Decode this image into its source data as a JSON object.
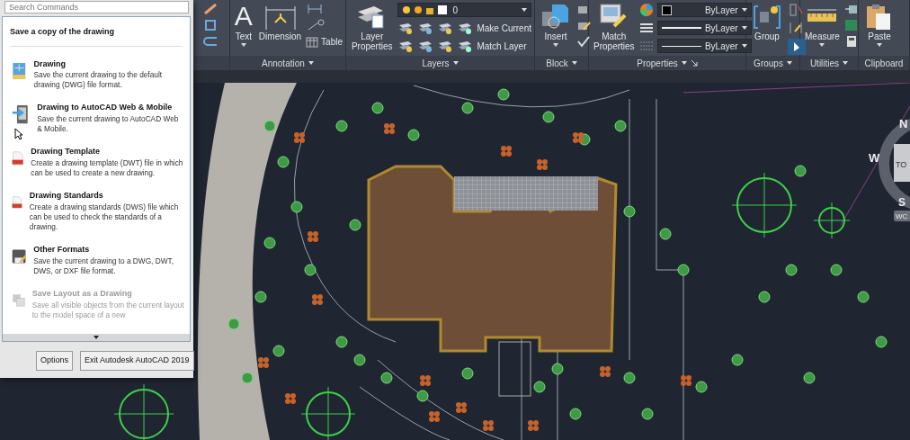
{
  "search": {
    "placeholder": "Search Commands"
  },
  "ribbon": {
    "panels": [
      {
        "title": "Annotation",
        "menu": true,
        "tools": [
          {
            "label": "Text",
            "menu": true,
            "glyph": "A"
          },
          {
            "label": "Dimension",
            "menu": false
          },
          {
            "label": "Table",
            "menu": false
          }
        ]
      },
      {
        "title": "Layers",
        "menu": true,
        "layer": "0",
        "tools": [
          {
            "label": "Layer Properties",
            "menu": false
          },
          {
            "label": "Make Current",
            "menu": false
          },
          {
            "label": "Match Layer",
            "menu": false
          }
        ]
      },
      {
        "title": "Block",
        "menu": true,
        "tools": [
          {
            "label": "Insert",
            "menu": true
          }
        ]
      },
      {
        "title": "Properties",
        "menu": true,
        "dropdowns": [
          "ByLayer",
          "ByLayer",
          "ByLayer"
        ],
        "tools": [
          {
            "label": "Match Properties",
            "menu": false
          }
        ]
      },
      {
        "title": "Groups",
        "menu": true,
        "tools": [
          {
            "label": "Group",
            "menu": false
          }
        ]
      },
      {
        "title": "Utilities",
        "menu": true,
        "tools": [
          {
            "label": "Measure",
            "menu": true
          }
        ]
      },
      {
        "title": "Clipboard",
        "menu": false,
        "tools": [
          {
            "label": "Paste",
            "menu": true
          }
        ]
      }
    ]
  },
  "menu": {
    "header": "Save a copy of the drawing",
    "items": [
      {
        "title": "Drawing",
        "description": "Save the current drawing to the default drawing (DWG) file format.",
        "disabled": false
      },
      {
        "title": "Drawing to AutoCAD Web & Mobile",
        "description": "Save the current drawing to AutoCAD Web & Mobile.",
        "disabled": false
      },
      {
        "title": "Drawing Template",
        "description": "Create a drawing template (DWT) file in which can be used to create a new drawing.",
        "disabled": false
      },
      {
        "title": "Drawing Standards",
        "description": "Create a drawing standards (DWS) file which can be used to check the standards of a drawing.",
        "disabled": false
      },
      {
        "title": "Other Formats",
        "description": "Save the current drawing to a DWG, DWT, DWS, or DXF file format.",
        "disabled": false
      },
      {
        "title": "Save Layout as a Drawing",
        "description": "Save all visible objects from the current layout to the model space of a new",
        "disabled": true
      }
    ],
    "buttons": [
      "Options",
      "Exit Autodesk AutoCAD 2019"
    ]
  },
  "viewcube": {
    "north": "N",
    "west": "W",
    "south": "S",
    "face": "TO",
    "ucs": "WC"
  }
}
